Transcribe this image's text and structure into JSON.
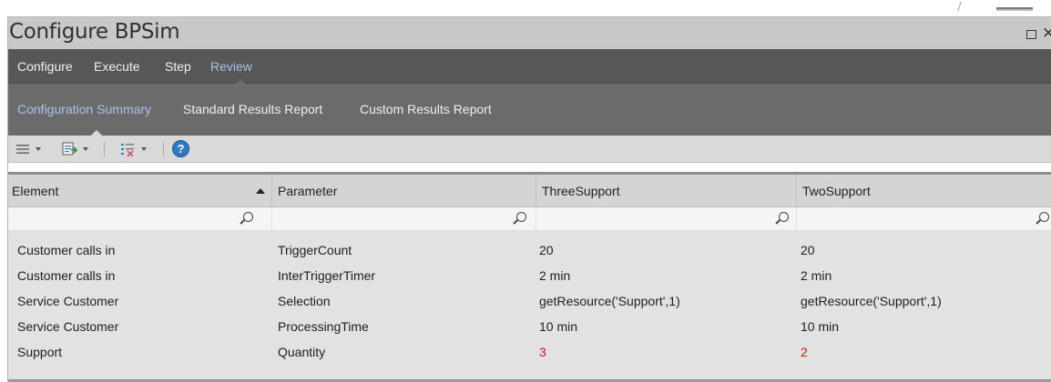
{
  "window": {
    "title": "Configure BPSim"
  },
  "ribbon": {
    "tabs": [
      {
        "label": "Configure",
        "active": false
      },
      {
        "label": "Execute",
        "active": false
      },
      {
        "label": "Step",
        "active": false
      },
      {
        "label": "Review",
        "active": true
      }
    ],
    "panel_tabs": [
      {
        "label": "Configuration Summary",
        "active": true
      },
      {
        "label": "Standard Results Report",
        "active": false
      },
      {
        "label": "Custom Results Report",
        "active": false
      }
    ]
  },
  "toolbar": {
    "icons": [
      "menu-icon",
      "export-icon",
      "filter-options-icon",
      "help-icon"
    ],
    "help_label": "?"
  },
  "grid": {
    "columns": [
      "Element",
      "Parameter",
      "ThreeSupport",
      "TwoSupport"
    ],
    "sort": {
      "column": "Element",
      "direction": "ascending"
    },
    "rows": [
      [
        "Customer calls in",
        "TriggerCount",
        "20",
        "20"
      ],
      [
        "Customer calls in",
        "InterTriggerTimer",
        "2 min",
        "2 min"
      ],
      [
        "Service Customer",
        "Selection",
        "getResource('Support',1)",
        "getResource('Support',1)"
      ],
      [
        "Service Customer",
        "ProcessingTime",
        "10 min",
        "10 min"
      ],
      [
        "Support",
        "Quantity",
        "3",
        "2"
      ]
    ],
    "highlight_color": "#e01010"
  },
  "colors": {
    "ribbon_bg": "#575757",
    "active_tab": "#a6c4ea"
  }
}
